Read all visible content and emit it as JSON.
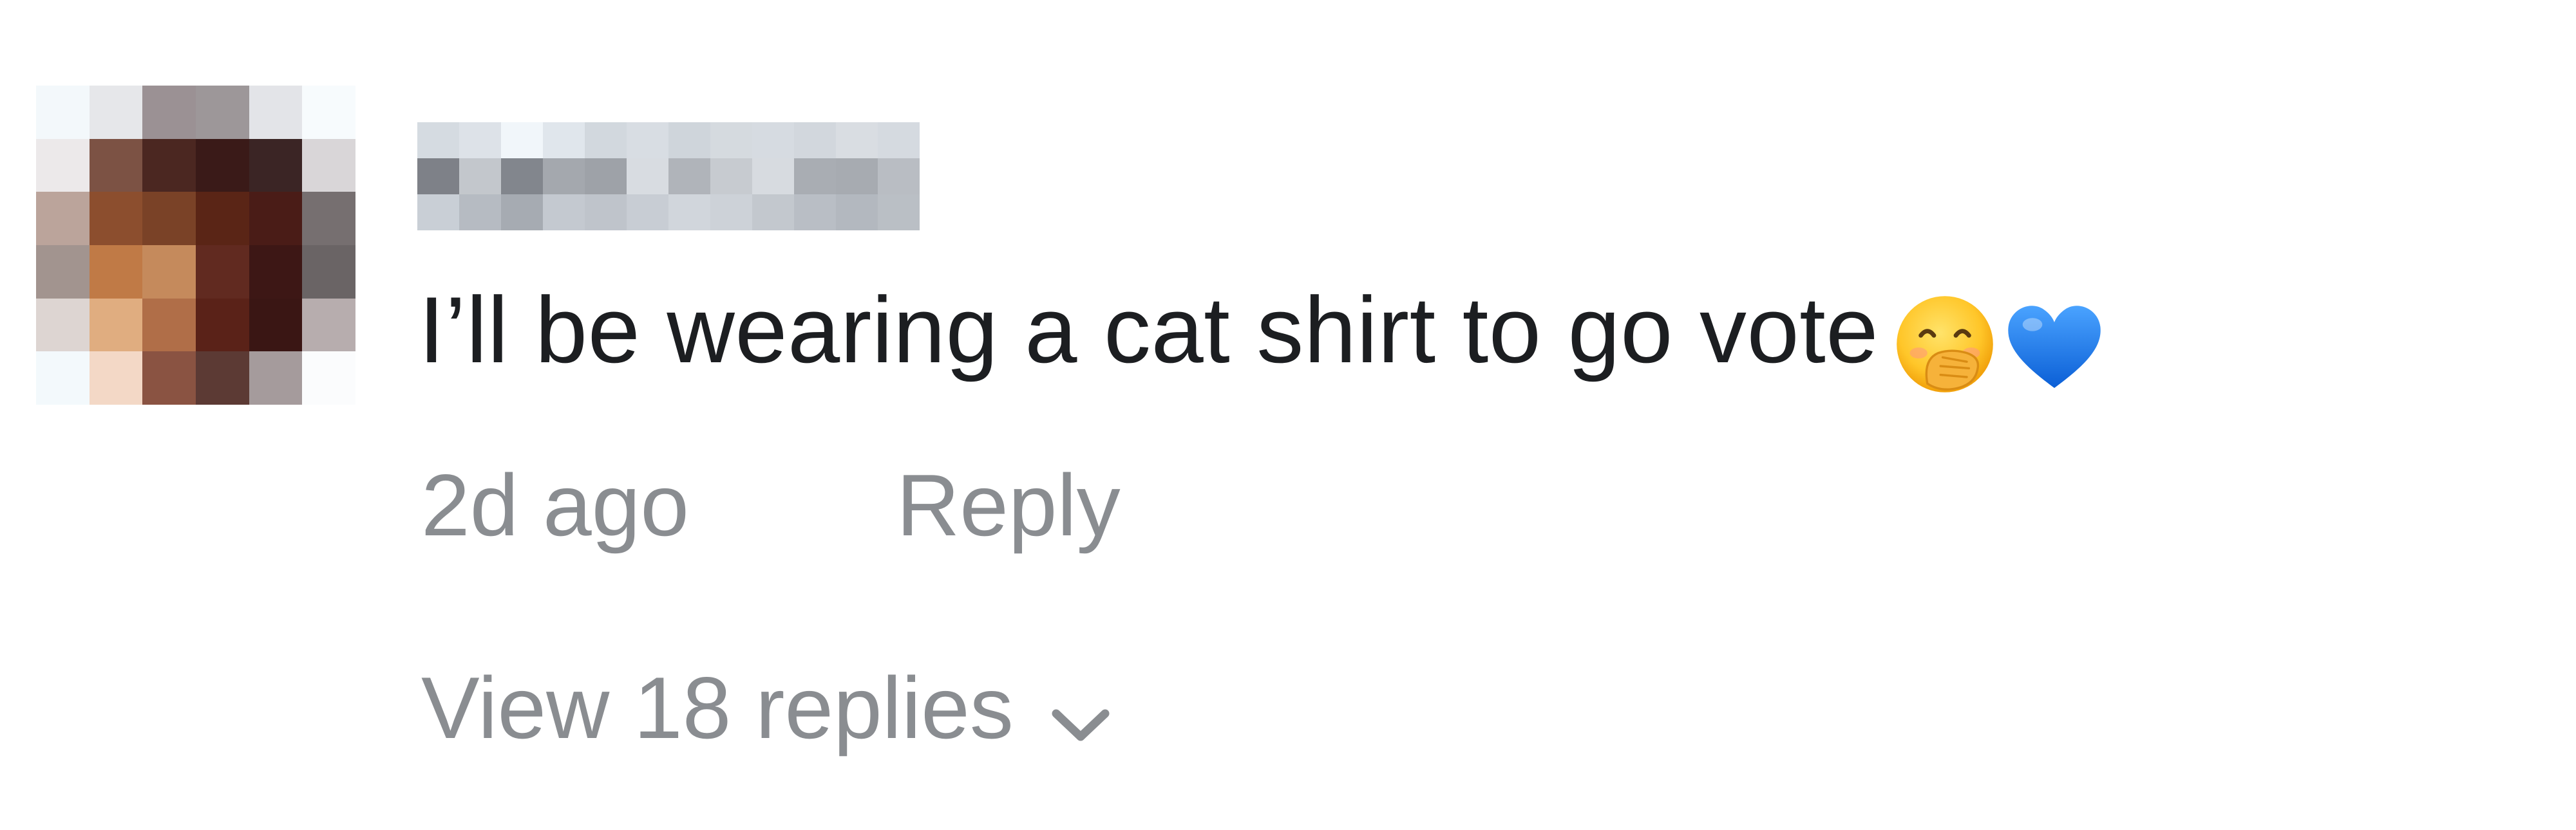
{
  "comment": {
    "text": "I’ll be wearing a cat shirt to go vote",
    "emojis": [
      "face-with-hand-over-mouth-icon",
      "blue-heart-icon"
    ],
    "time": "2d ago",
    "reply_label": "Reply",
    "view_replies_label": "View 18 replies"
  },
  "colors": {
    "text": "#1c1e21",
    "meta": "#8a8d91",
    "heart": "#1877f2"
  }
}
